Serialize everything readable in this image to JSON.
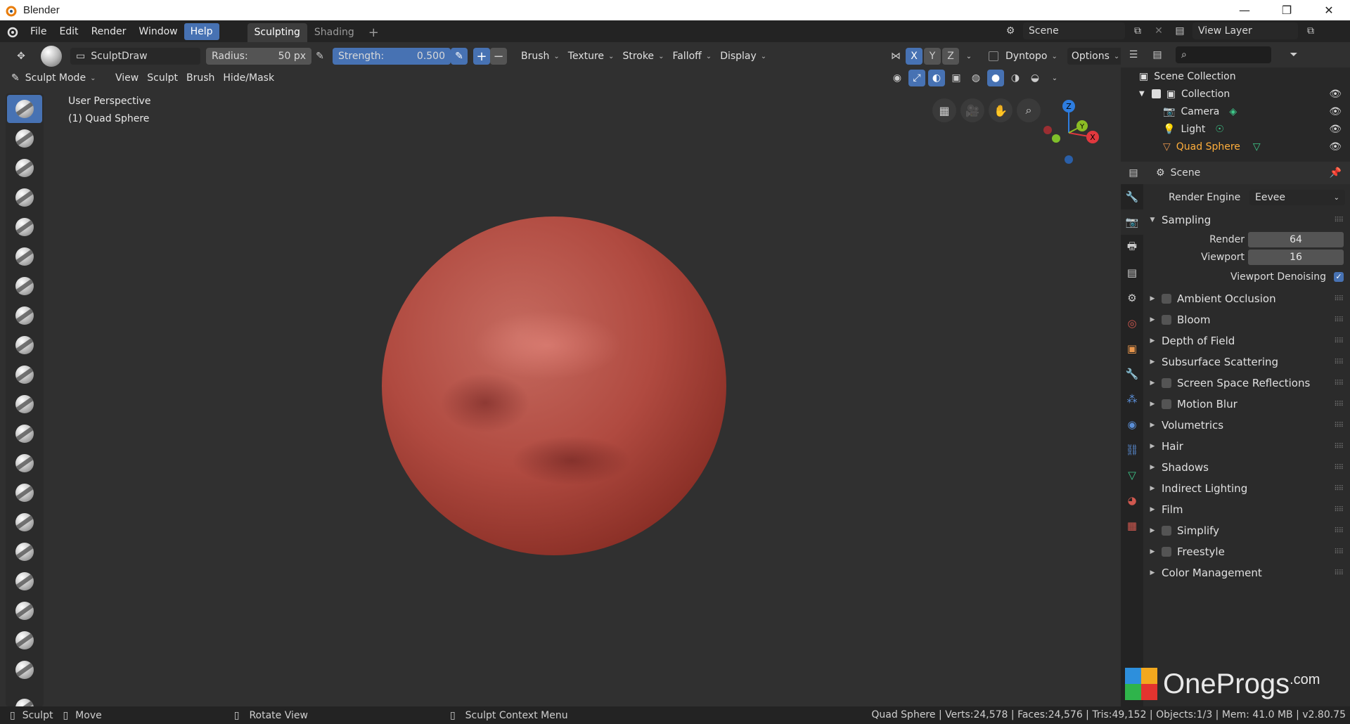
{
  "window": {
    "title": "Blender",
    "minimize": "—",
    "maximize": "❐",
    "close": "✕"
  },
  "menubar": {
    "items": [
      "File",
      "Edit",
      "Render",
      "Window",
      "Help"
    ],
    "active_index": 4,
    "workspaces": [
      "Sculpting",
      "Shading"
    ],
    "active_workspace": 0,
    "add_tab": "+",
    "scene": "Scene",
    "view_layer": "View Layer"
  },
  "tool_header": {
    "brush_name": "SculptDraw",
    "radius_label": "Radius:",
    "radius_value": "50 px",
    "strength_label": "Strength:",
    "strength_value": "0.500",
    "plus": "+",
    "minus": "−",
    "menus": [
      "Brush",
      "Texture",
      "Stroke",
      "Falloff",
      "Display"
    ],
    "axes": [
      "X",
      "Y",
      "Z"
    ],
    "dyntopo": "Dyntopo",
    "options": "Options"
  },
  "mode_header": {
    "mode": "Sculpt Mode",
    "menus": [
      "View",
      "Sculpt",
      "Brush",
      "Hide/Mask"
    ]
  },
  "viewport": {
    "info_line1": "User Perspective",
    "info_line2": "(1) Quad Sphere",
    "gizmo": {
      "x": "X",
      "y": "Y",
      "z": "Z"
    },
    "colors": {
      "x": "#e0383e",
      "y": "#8cbd24",
      "z": "#2d7de0",
      "mesh": "#a8453b"
    }
  },
  "outliner": {
    "root": "Scene Collection",
    "collection": "Collection",
    "items": [
      "Camera",
      "Light",
      "Quad Sphere"
    ],
    "selected": "Quad Sphere"
  },
  "properties": {
    "header": "Scene",
    "render_engine_label": "Render Engine",
    "render_engine_value": "Eevee",
    "sampling": {
      "title": "Sampling",
      "render_label": "Render",
      "render_value": "64",
      "viewport_label": "Viewport",
      "viewport_value": "16",
      "denoise_label": "Viewport Denoising",
      "denoise_checked": true
    },
    "sections": [
      {
        "label": "Ambient Occlusion",
        "checkbox": true
      },
      {
        "label": "Bloom",
        "checkbox": true
      },
      {
        "label": "Depth of Field",
        "checkbox": false
      },
      {
        "label": "Subsurface Scattering",
        "checkbox": false
      },
      {
        "label": "Screen Space Reflections",
        "checkbox": true
      },
      {
        "label": "Motion Blur",
        "checkbox": true
      },
      {
        "label": "Volumetrics",
        "checkbox": false
      },
      {
        "label": "Hair",
        "checkbox": false
      },
      {
        "label": "Shadows",
        "checkbox": false
      },
      {
        "label": "Indirect Lighting",
        "checkbox": false
      },
      {
        "label": "Film",
        "checkbox": false
      },
      {
        "label": "Simplify",
        "checkbox": true
      },
      {
        "label": "Freestyle",
        "checkbox": true
      },
      {
        "label": "Color Management",
        "checkbox": false
      }
    ]
  },
  "statusbar": {
    "sculpt": "Sculpt",
    "move": "Move",
    "rotate": "Rotate View",
    "context": "Sculpt Context Menu",
    "stats": "Quad Sphere | Verts:24,578 | Faces:24,576 | Tris:49,152 | Objects:1/3 | Mem: 41.0 MB | v2.80.75"
  },
  "watermark": {
    "text": "OneProgs",
    "suffix": ".com"
  }
}
